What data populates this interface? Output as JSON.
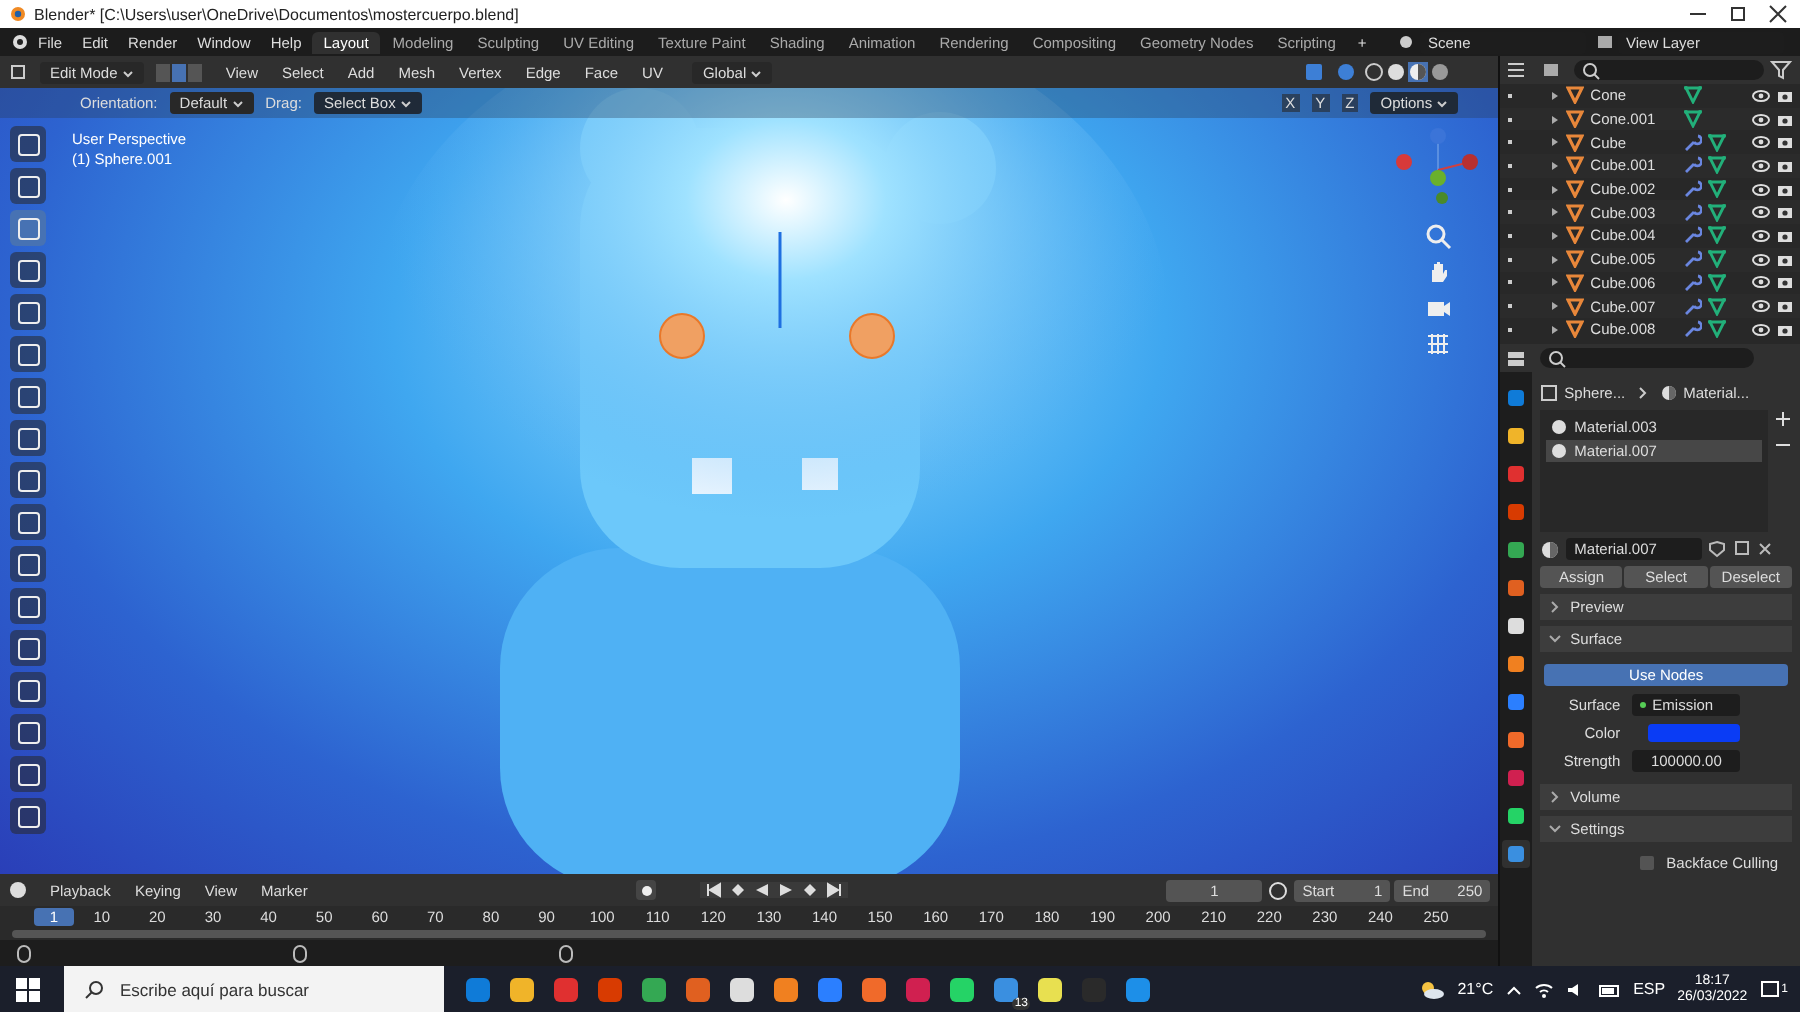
{
  "window": {
    "title": "Blender* [C:\\Users\\user\\OneDrive\\Documentos\\mostercuerpo.blend]"
  },
  "menu": [
    "File",
    "Edit",
    "Render",
    "Window",
    "Help"
  ],
  "workspace_tabs": [
    {
      "label": "Layout",
      "selected": true
    },
    {
      "label": "Modeling",
      "selected": false
    },
    {
      "label": "Sculpting",
      "selected": false
    },
    {
      "label": "UV Editing",
      "selected": false
    },
    {
      "label": "Texture Paint",
      "selected": false
    },
    {
      "label": "Shading",
      "selected": false
    },
    {
      "label": "Animation",
      "selected": false
    },
    {
      "label": "Rendering",
      "selected": false
    },
    {
      "label": "Compositing",
      "selected": false
    },
    {
      "label": "Geometry Nodes",
      "selected": false
    },
    {
      "label": "Scripting",
      "selected": false
    }
  ],
  "add_tab": "+",
  "scene": "Scene",
  "view_layer": "View Layer",
  "viewport_header": {
    "mode": "Edit Mode",
    "select_modes": [
      {
        "selected": false
      },
      {
        "selected": true
      },
      {
        "selected": false
      }
    ],
    "menus": [
      "View",
      "Select",
      "Add",
      "Mesh",
      "Vertex",
      "Edge",
      "Face",
      "UV"
    ],
    "orientation": "Global"
  },
  "tool_settings": {
    "orientation_label": "Orientation:",
    "orientation": "Default",
    "drag_label": "Drag:",
    "drag": "Select Box",
    "axes": [
      "X",
      "Y",
      "Z"
    ],
    "options": "Options"
  },
  "viewport": {
    "view_name": "User Perspective",
    "object_name": "(1) Sphere.001"
  },
  "tools": [
    {
      "selected": false
    },
    {
      "selected": false
    },
    {
      "selected": true
    },
    {
      "selected": false
    },
    {
      "selected": false
    },
    {
      "selected": false
    },
    {
      "selected": false
    },
    {
      "selected": false
    },
    {
      "selected": false
    },
    {
      "selected": false
    },
    {
      "selected": false
    },
    {
      "selected": false
    },
    {
      "selected": false
    },
    {
      "selected": false
    },
    {
      "selected": false
    },
    {
      "selected": false
    },
    {
      "selected": false
    }
  ],
  "outliner": {
    "items": [
      {
        "name": "Cone",
        "modifier": false
      },
      {
        "name": "Cone.001",
        "modifier": false
      },
      {
        "name": "Cube",
        "modifier": true
      },
      {
        "name": "Cube.001",
        "modifier": true
      },
      {
        "name": "Cube.002",
        "modifier": true
      },
      {
        "name": "Cube.003",
        "modifier": true
      },
      {
        "name": "Cube.004",
        "modifier": true
      },
      {
        "name": "Cube.005",
        "modifier": true
      },
      {
        "name": "Cube.006",
        "modifier": true
      },
      {
        "name": "Cube.007",
        "modifier": true
      },
      {
        "name": "Cube.008",
        "modifier": true
      }
    ]
  },
  "properties": {
    "tabs": [
      {
        "selected": false
      },
      {
        "selected": false
      },
      {
        "selected": false
      },
      {
        "selected": false
      },
      {
        "selected": false
      },
      {
        "selected": false
      },
      {
        "selected": false
      },
      {
        "selected": false
      },
      {
        "selected": false
      },
      {
        "selected": false
      },
      {
        "selected": false
      },
      {
        "selected": false
      },
      {
        "selected": true
      }
    ],
    "breadcrumb": [
      "Sphere...",
      "Material..."
    ],
    "slots": [
      {
        "name": "Material.003",
        "selected": false
      },
      {
        "name": "Material.007",
        "selected": true
      }
    ],
    "material": "Material.007",
    "slot_buttons": [
      "Assign",
      "Select",
      "Deselect"
    ],
    "panels": [
      {
        "title": "Preview",
        "expanded": false
      },
      {
        "title": "Surface",
        "expanded": true
      },
      {
        "title": "Volume",
        "expanded": false
      },
      {
        "title": "Settings",
        "expanded": true
      }
    ],
    "use_nodes": "Use Nodes",
    "surface_label": "Surface",
    "surface": "Emission",
    "color_label": "Color",
    "color": "#0a3cf5",
    "strength_label": "Strength",
    "strength": "100000.00",
    "backface_culling": {
      "label": "Backface Culling",
      "checked": false
    }
  },
  "timeline": {
    "menus": [
      "Playback",
      "Keying",
      "View",
      "Marker"
    ],
    "current_frame": "1",
    "start_label": "Start",
    "start": "1",
    "end_label": "End",
    "end": "250",
    "frames": [
      {
        "label": "1",
        "selected": true
      },
      {
        "label": "10",
        "selected": false
      },
      {
        "label": "20",
        "selected": false
      },
      {
        "label": "30",
        "selected": false
      },
      {
        "label": "40",
        "selected": false
      },
      {
        "label": "50",
        "selected": false
      },
      {
        "label": "60",
        "selected": false
      },
      {
        "label": "70",
        "selected": false
      },
      {
        "label": "80",
        "selected": false
      },
      {
        "label": "90",
        "selected": false
      },
      {
        "label": "100",
        "selected": false
      },
      {
        "label": "110",
        "selected": false
      },
      {
        "label": "120",
        "selected": false
      },
      {
        "label": "130",
        "selected": false
      },
      {
        "label": "140",
        "selected": false
      },
      {
        "label": "150",
        "selected": false
      },
      {
        "label": "160",
        "selected": false
      },
      {
        "label": "170",
        "selected": false
      },
      {
        "label": "180",
        "selected": false
      },
      {
        "label": "190",
        "selected": false
      },
      {
        "label": "200",
        "selected": false
      },
      {
        "label": "210",
        "selected": false
      },
      {
        "label": "220",
        "selected": false
      },
      {
        "label": "230",
        "selected": false
      },
      {
        "label": "240",
        "selected": false
      },
      {
        "label": "250",
        "selected": false
      }
    ]
  },
  "taskbar": {
    "search_placeholder": "Escribe aquí para buscar",
    "mail_badge": "13",
    "temperature": "21°C",
    "language": "ESP",
    "time": "18:17",
    "date": "26/03/2022",
    "notifications": "1"
  }
}
